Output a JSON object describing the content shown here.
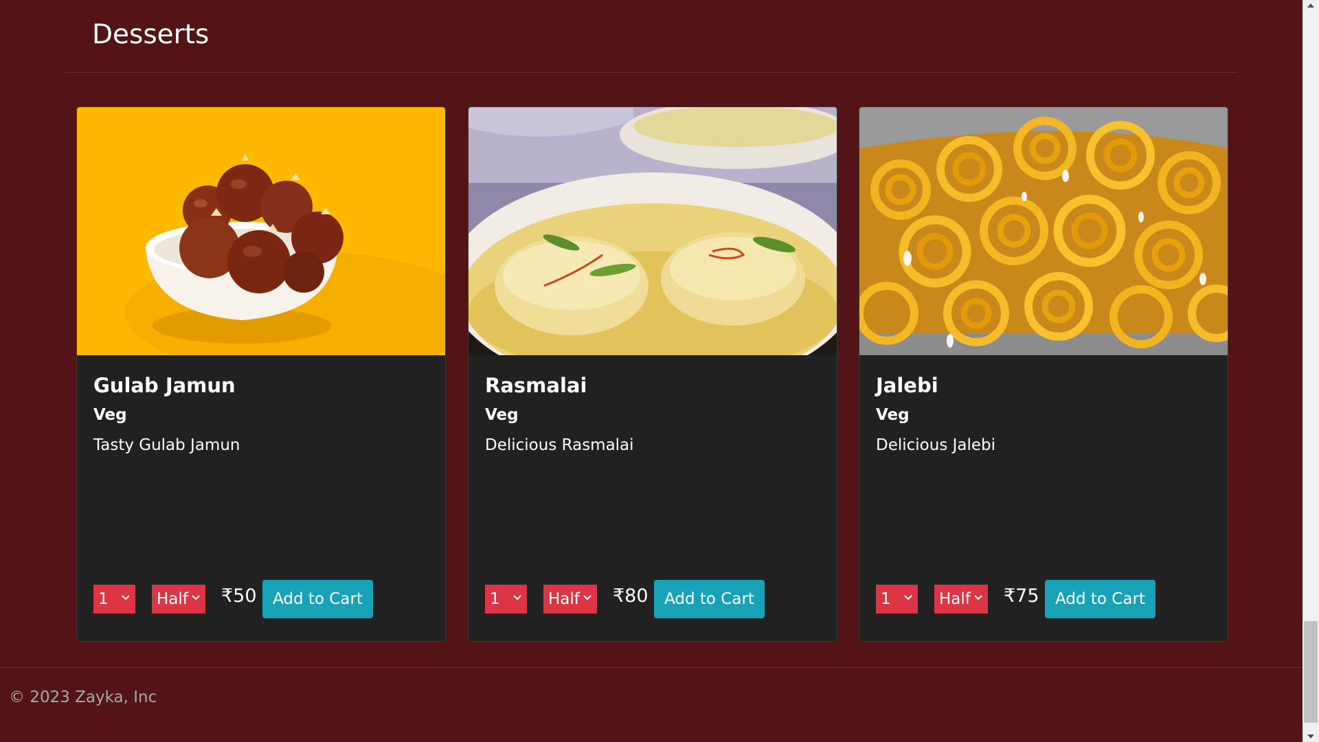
{
  "section": {
    "title": "Desserts"
  },
  "items": [
    {
      "name": "Gulab Jamun",
      "type": "Veg",
      "description": "Tasty Gulab Jamun",
      "quantity": "1",
      "size": "Half",
      "price": "₹50",
      "button_label": "Add to Cart",
      "image_background": "#FDB900"
    },
    {
      "name": "Rasmalai",
      "type": "Veg",
      "description": "Delicious Rasmalai",
      "quantity": "1",
      "size": "Half",
      "price": "₹80",
      "button_label": "Add to Cart",
      "image_background": "#E6C96A"
    },
    {
      "name": "Jalebi",
      "type": "Veg",
      "description": "Delicious Jalebi",
      "quantity": "1",
      "size": "Half",
      "price": "₹75",
      "button_label": "Add to Cart",
      "image_background": "#E7A615"
    }
  ],
  "footer": {
    "text": "© 2023 Zayka, Inc"
  },
  "colors": {
    "page_background": "#531417",
    "card_background": "#212121",
    "select_background": "#DC3545",
    "button_background": "#17A2B8"
  },
  "icons": {
    "select_indicator": "chevron-down-icon",
    "scroll_up": "scroll-up-arrow-icon",
    "scroll_down": "scroll-down-arrow-icon"
  },
  "scrollbar": {
    "position_fraction": 0.9
  }
}
